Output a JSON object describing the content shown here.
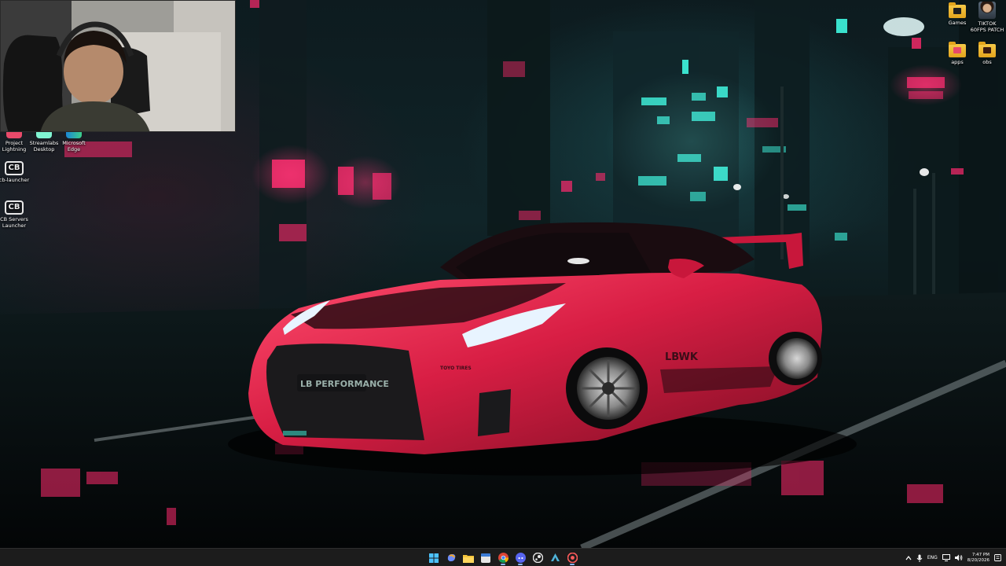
{
  "desktop": {
    "left_icons": [
      {
        "label": "Project Lightning"
      },
      {
        "label": "Streamlabs Desktop"
      },
      {
        "label": "Microsoft Edge"
      },
      {
        "label": "cb-launcher"
      },
      {
        "label": "CB Servers Launcher"
      }
    ],
    "right_icons": [
      {
        "label": "Games"
      },
      {
        "label": "TIKTOK 60FPS PATCH"
      },
      {
        "label": "apps"
      },
      {
        "label": "obs"
      }
    ],
    "car_branding": {
      "plate": "LB PERFORMANCE",
      "door_decal": "LBWK",
      "bumper_decal": "TOYO TIRES"
    }
  },
  "taskbar": {
    "pinned": [
      {
        "icon": "windows-start-icon"
      },
      {
        "icon": "copilot-icon"
      },
      {
        "icon": "file-explorer-icon"
      },
      {
        "icon": "calendar-app-icon"
      },
      {
        "icon": "chrome-icon"
      },
      {
        "icon": "discord-icon"
      },
      {
        "icon": "steam-icon"
      },
      {
        "icon": "app-icon"
      },
      {
        "icon": "streamlabs-icon"
      }
    ],
    "tray": {
      "language": "ENG",
      "time": "7:47 PM",
      "date": "8/20/2026"
    }
  },
  "colors": {
    "taskbar_bg": "#1c1c1c",
    "car_red": "#d81e44",
    "neon_pink": "#ff2a6d",
    "neon_cyan": "#3ff7e0"
  }
}
